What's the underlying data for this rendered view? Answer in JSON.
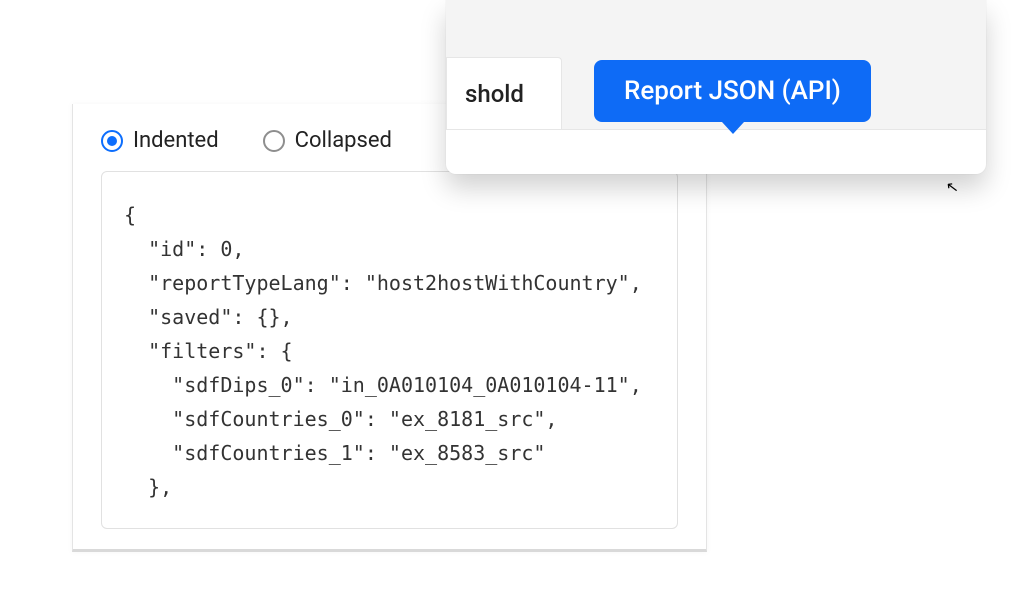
{
  "radios": {
    "indented": "Indented",
    "collapsed": "Collapsed"
  },
  "code": "{\n  \"id\": 0,\n  \"reportTypeLang\": \"host2hostWithCountry\",\n  \"saved\": {},\n  \"filters\": {\n    \"sdfDips_0\": \"in_0A010104_0A010104-11\",\n    \"sdfCountries_0\": \"ex_8181_src\",\n    \"sdfCountries_1\": \"ex_8583_src\"\n  },",
  "tab": {
    "active_fragment": "shold"
  },
  "tooltip": {
    "label": "Report JSON (API)"
  }
}
